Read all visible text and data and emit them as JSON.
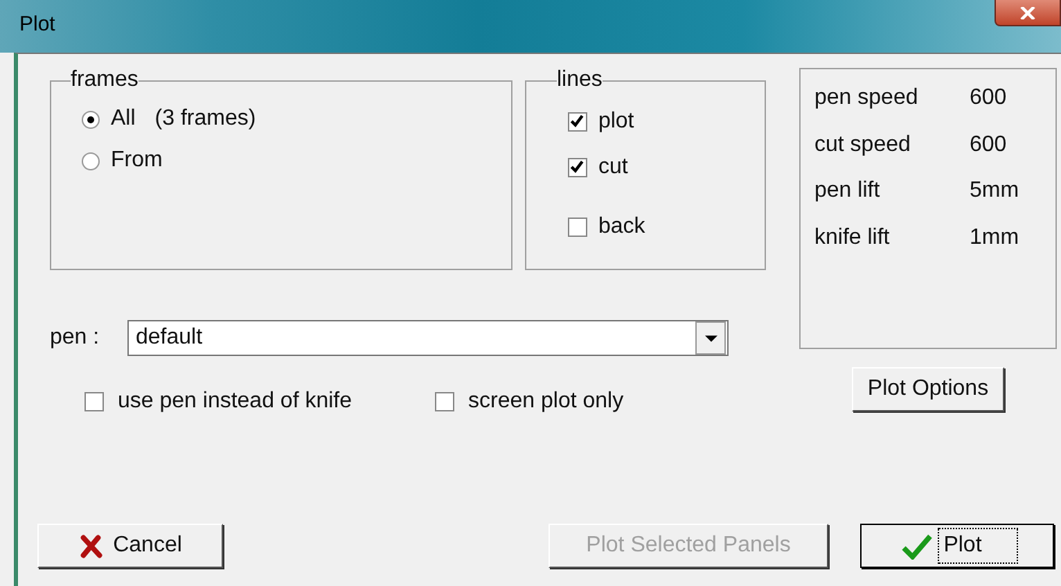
{
  "window": {
    "title": "Plot"
  },
  "frames": {
    "title": "frames",
    "options": [
      {
        "label": "All",
        "note": "(3 frames)",
        "selected": true
      },
      {
        "label": "From",
        "selected": false
      }
    ]
  },
  "lines": {
    "title": "lines",
    "options": [
      {
        "label": "plot",
        "checked": true
      },
      {
        "label": "cut",
        "checked": true
      },
      {
        "label": "back",
        "checked": false
      }
    ]
  },
  "settings": [
    {
      "name": "pen speed",
      "value": "600"
    },
    {
      "name": "cut speed",
      "value": "600"
    },
    {
      "name": "pen lift",
      "value": "5mm"
    },
    {
      "name": "knife lift",
      "value": "1mm"
    }
  ],
  "plot_options_button": "Plot Options",
  "pen": {
    "label": "pen :",
    "value": "default"
  },
  "options": [
    {
      "label": "use pen instead of knife",
      "checked": false
    },
    {
      "label": "screen plot only",
      "checked": false
    }
  ],
  "buttons": [
    {
      "label": "Cancel",
      "kind": "cancel",
      "disabled": false,
      "focused": false
    },
    {
      "label": "Plot Selected Panels",
      "kind": "plain",
      "disabled": true,
      "focused": false
    },
    {
      "label": "Plot",
      "kind": "ok",
      "disabled": false,
      "focused": true
    }
  ]
}
